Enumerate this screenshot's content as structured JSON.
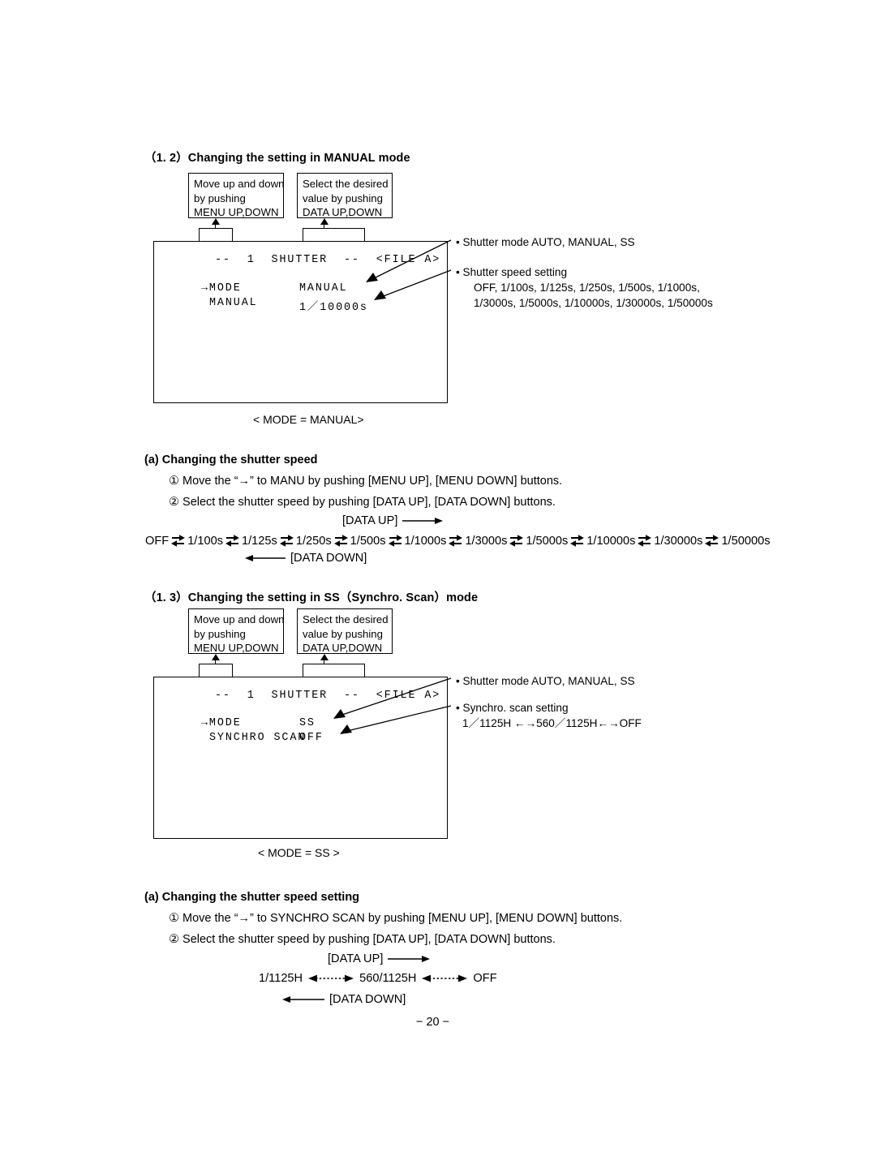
{
  "page": {
    "number": "− 20 −"
  },
  "section_manual": {
    "heading": "（1. 2）Changing the setting in MANUAL mode",
    "callout_left": {
      "line1": "Move up and down",
      "line2": "by pushing",
      "line3": "MENU UP,DOWN"
    },
    "callout_right": {
      "line1": "Select the desired",
      "line2": "value by pushing",
      "line3": "DATA UP,DOWN"
    },
    "monitor": {
      "title": "--  1  SHUTTER  --  <FILE A>",
      "row1_label": "→MODE",
      "row1_value": "MANUAL",
      "row2_label": "MANUAL",
      "row2_value": "1／10000s"
    },
    "caption": "< MODE = MANUAL>",
    "annotations": [
      {
        "title": "• Shutter mode    AUTO, MANUAL, SS",
        "lines": []
      },
      {
        "title": "• Shutter speed setting",
        "lines": [
          "OFF, 1/100s, 1/125s, 1/250s, 1/500s, 1/1000s,",
          "1/3000s, 1/5000s, 1/10000s, 1/30000s, 1/50000s"
        ]
      }
    ],
    "sub_heading": "(a) Changing the shutter speed",
    "steps": [
      "① Move the “→” to MANU by pushing [MENU UP], [MENU DOWN] buttons.",
      "② Select the shutter speed by pushing [DATA UP], [DATA DOWN] buttons."
    ],
    "data_up_label": "[DATA UP]",
    "data_down_label": "[DATA DOWN]",
    "sequence": [
      "OFF",
      "1/100s",
      "1/125s",
      "1/250s",
      "1/500s",
      "1/1000s",
      "1/3000s",
      "1/5000s",
      "1/10000s",
      "1/30000s",
      "1/50000s"
    ]
  },
  "section_ss": {
    "heading": "（1. 3）Changing the setting in SS（Synchro. Scan）mode",
    "callout_left": {
      "line1": "Move up and down",
      "line2": "by pushing",
      "line3": "MENU UP,DOWN"
    },
    "callout_right": {
      "line1": "Select the desired",
      "line2": "value by pushing",
      "line3": "DATA UP,DOWN"
    },
    "monitor": {
      "title": "--  1  SHUTTER  --  <FILE A>",
      "row1_label": "→MODE",
      "row1_value": "SS",
      "row2_label": "SYNCHRO SCAN",
      "row2_value": "OFF"
    },
    "caption": "< MODE = SS >",
    "annotations": [
      {
        "title": "• Shutter mode    AUTO, MANUAL, SS",
        "lines": []
      },
      {
        "title": "• Synchro. scan setting",
        "lines": [
          "1／1125H ←→560／1125H←→OFF"
        ]
      }
    ],
    "sub_heading": "(a) Changing the shutter speed setting",
    "steps": [
      "① Move the “→” to SYNCHRO SCAN by pushing [MENU UP], [MENU DOWN] buttons.",
      "② Select the shutter speed by pushing [DATA UP], [DATA DOWN] buttons."
    ],
    "data_up_label": "[DATA UP]",
    "data_down_label": "[DATA DOWN]",
    "sequence": [
      "1/1125H",
      "560/1125H",
      "OFF"
    ]
  },
  "colors": {
    "ink": "#000000",
    "paper": "#ffffff"
  }
}
